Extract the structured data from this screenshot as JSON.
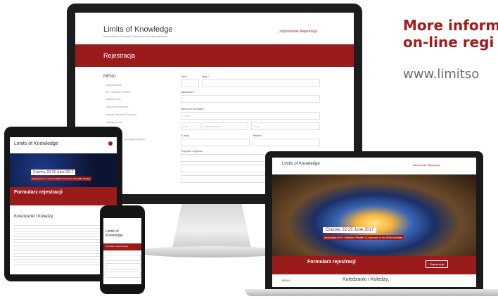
{
  "promo": {
    "line1": "More inform",
    "line2": "on-line regi",
    "line3": "www.limitso"
  },
  "desktop": {
    "logo": "Limits of Knowledge",
    "subtitle": "International Scientific Conference Interdisciplinary",
    "nav": "Zaproszenie   Rejestracja",
    "banner_title": "Rejestracja",
    "menu_title": "MENU",
    "menu_items": [
      "Zaproszenie",
      "Dr. Heinrich Pfeiffer",
      "Aktualności",
      "Księgi konferencji",
      "Księgi Wiedzy & Nauczy",
      "Zarządzenie"
    ],
    "fields": {
      "tytul": "Tytuł",
      "imie": "Imię *",
      "nazwisko": "Nazwisko *",
      "adres": "Adres do kontaktu *",
      "ulica": "Ulica",
      "kod": "Kod",
      "miejscowosc": "Miejscowość",
      "kraj": "Kraj",
      "email": "E-mail",
      "telefon": "Telefon",
      "instytucja": "Stanowisko / Instytucja",
      "program": "Program wyjazdu"
    },
    "trailing_text": "ja organizacyjna"
  },
  "tablet": {
    "logo": "Limits of Knowledge",
    "date": "Cracow, 22-25 June 2017",
    "caption": "dedicated to Fr. Heinrich Pfeiffer SJ honour of his 80th birthday",
    "form_title": "Formularz rejestracji",
    "section": "Koledzanki i Koledzy,"
  },
  "phone": {
    "logo": "Limits of Knowledge",
    "bar": "Formularz zgłoszeniowy"
  },
  "laptop": {
    "logo": "Limits of Knowledge",
    "nav": "Zaproszenie   Rejestracja",
    "date": "Cracow, 22-25 June 2017",
    "caption": "dedicated to Fr. Heinrich Pfeiffer SJ honour of his 80th birthday",
    "form_title": "Formularz rejestracji",
    "button": "Rejestracja",
    "menu": "MENU",
    "section": "Koledzanki i Koledzy,"
  }
}
